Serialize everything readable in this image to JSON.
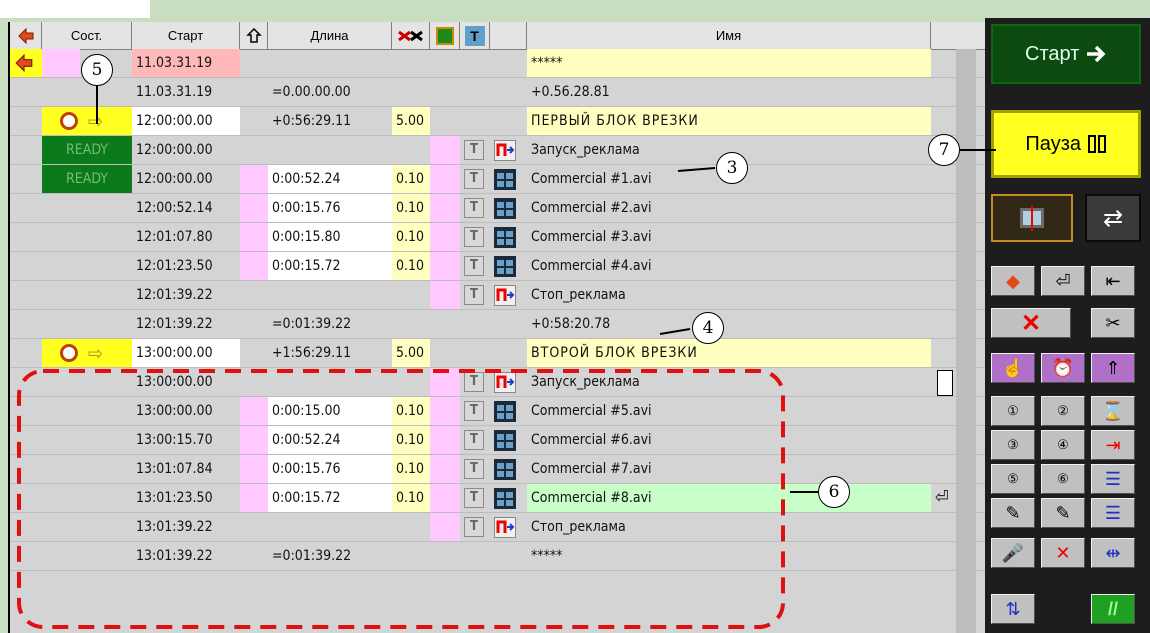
{
  "columns": {
    "state": "Сост.",
    "start": "Старт",
    "length": "Длина",
    "name": "Имя"
  },
  "rows": [
    {
      "start": "11.03.31.19",
      "length": "",
      "trans": "",
      "name": "*****",
      "kind": "first"
    },
    {
      "start": "11.03.31.19",
      "length": "=0.00.00.00",
      "trans": "",
      "name": "+0.56.28.81",
      "kind": "info"
    },
    {
      "start": "12:00:00.00",
      "length": "+0:56:29.11",
      "trans": "5.00",
      "name": "ПЕРВЫЙ БЛОК ВРЕЗКИ",
      "kind": "block"
    },
    {
      "state": "READY",
      "start": "12:00:00.00",
      "length": "",
      "trans": "",
      "name": "Запуск_реклама",
      "kind": "cmd"
    },
    {
      "state": "READY",
      "start": "12:00:00.00",
      "length": "0:00:52.24",
      "trans": "0.10",
      "name": "Commercial #1.avi",
      "kind": "clip"
    },
    {
      "start": "12:00:52.14",
      "length": "0:00:15.76",
      "trans": "0.10",
      "name": "Commercial #2.avi",
      "kind": "clip"
    },
    {
      "start": "12:01:07.80",
      "length": "0:00:15.80",
      "trans": "0.10",
      "name": "Commercial #3.avi",
      "kind": "clip"
    },
    {
      "start": "12:01:23.50",
      "length": "0:00:15.72",
      "trans": "0.10",
      "name": "Commercial #4.avi",
      "kind": "clip"
    },
    {
      "start": "12:01:39.22",
      "length": "",
      "trans": "",
      "name": "Стоп_реклама",
      "kind": "cmd"
    },
    {
      "start": "12:01:39.22",
      "length": "=0:01:39.22",
      "trans": "",
      "name": "+0:58:20.78",
      "kind": "info"
    },
    {
      "start": "13:00:00.00",
      "length": "+1:56:29.11",
      "trans": "5.00",
      "name": "ВТОРОЙ БЛОК ВРЕЗКИ",
      "kind": "block"
    },
    {
      "start": "13:00:00.00",
      "length": "",
      "trans": "",
      "name": "Запуск_реклама",
      "kind": "cmd"
    },
    {
      "start": "13:00:00.00",
      "length": "0:00:15.00",
      "trans": "0.10",
      "name": "Commercial #5.avi",
      "kind": "clip"
    },
    {
      "start": "13:00:15.70",
      "length": "0:00:52.24",
      "trans": "0.10",
      "name": "Commercial #6.avi",
      "kind": "clip"
    },
    {
      "start": "13:01:07.84",
      "length": "0:00:15.76",
      "trans": "0.10",
      "name": "Commercial #7.avi",
      "kind": "clip"
    },
    {
      "start": "13:01:23.50",
      "length": "0:00:15.72",
      "trans": "0.10",
      "name": "Commercial #8.avi",
      "kind": "clip-active"
    },
    {
      "start": "13:01:39.22",
      "length": "",
      "trans": "",
      "name": "Стоп_реклама",
      "kind": "cmd"
    },
    {
      "start": "13:01:39.22",
      "length": "=0:01:39.22",
      "trans": "",
      "name": "*****",
      "kind": "info"
    }
  ],
  "side": {
    "start_label": "Старт",
    "pause_label": "Пауза"
  },
  "callouts": [
    "5",
    "3",
    "4",
    "6",
    "7"
  ],
  "colors": {
    "yellow": "#ffff00",
    "pink": "#ffc8ff",
    "lightyellow": "#ffffc0",
    "green_btn": "#0a6a10",
    "red_dash": "#e01010"
  }
}
